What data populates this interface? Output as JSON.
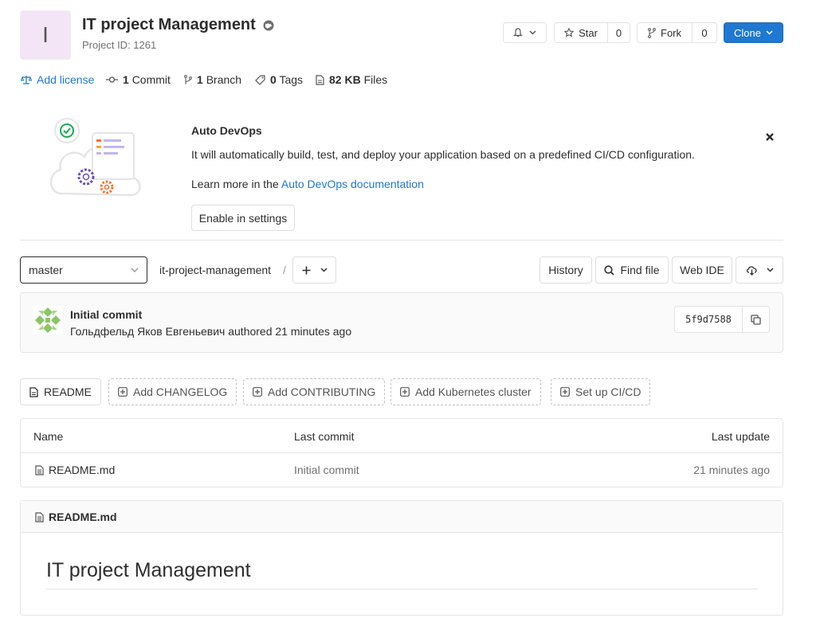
{
  "project": {
    "avatar_letter": "I",
    "title": "IT project Management",
    "id_label": "Project ID: 1261",
    "avatar_bg": "#f3e5f5"
  },
  "header_buttons": {
    "star_label": "Star",
    "star_count": "0",
    "fork_label": "Fork",
    "fork_count": "0",
    "clone_label": "Clone",
    "clone_color": "#1f78d1"
  },
  "stats": {
    "add_license": "Add license",
    "commits_count": "1",
    "commits_label": "Commit",
    "branches_count": "1",
    "branches_label": "Branch",
    "tags_count": "0",
    "tags_label": "Tags",
    "files_size": "82 KB",
    "files_label": "Files"
  },
  "devops": {
    "title": "Auto DevOps",
    "description": "It will automatically build, test, and deploy your application based on a predefined CI/CD configuration.",
    "learn_prefix": "Learn more in the ",
    "learn_link": "Auto DevOps documentation",
    "enable_button": "Enable in settings"
  },
  "nav": {
    "branch": "master",
    "path": "it-project-management",
    "path_separator": "/",
    "history": "History",
    "find_file": "Find file",
    "web_ide": "Web IDE"
  },
  "commit": {
    "title": "Initial commit",
    "author_line": "Гольдфельд Яков Евгеньевич authored 21 minutes ago",
    "sha": "5f9d7588"
  },
  "quick_links": [
    {
      "label": "README"
    },
    {
      "label": "Add CHANGELOG"
    },
    {
      "label": "Add CONTRIBUTING"
    },
    {
      "label": "Add Kubernetes cluster"
    },
    {
      "label": "Set up CI/CD"
    }
  ],
  "file_table": {
    "headers": [
      "Name",
      "Last commit",
      "Last update"
    ],
    "rows": [
      {
        "name": "README.md",
        "last_commit": "Initial commit",
        "last_update": "21 minutes ago"
      }
    ]
  },
  "readme": {
    "filename": "README.md",
    "heading": "IT project Management"
  }
}
